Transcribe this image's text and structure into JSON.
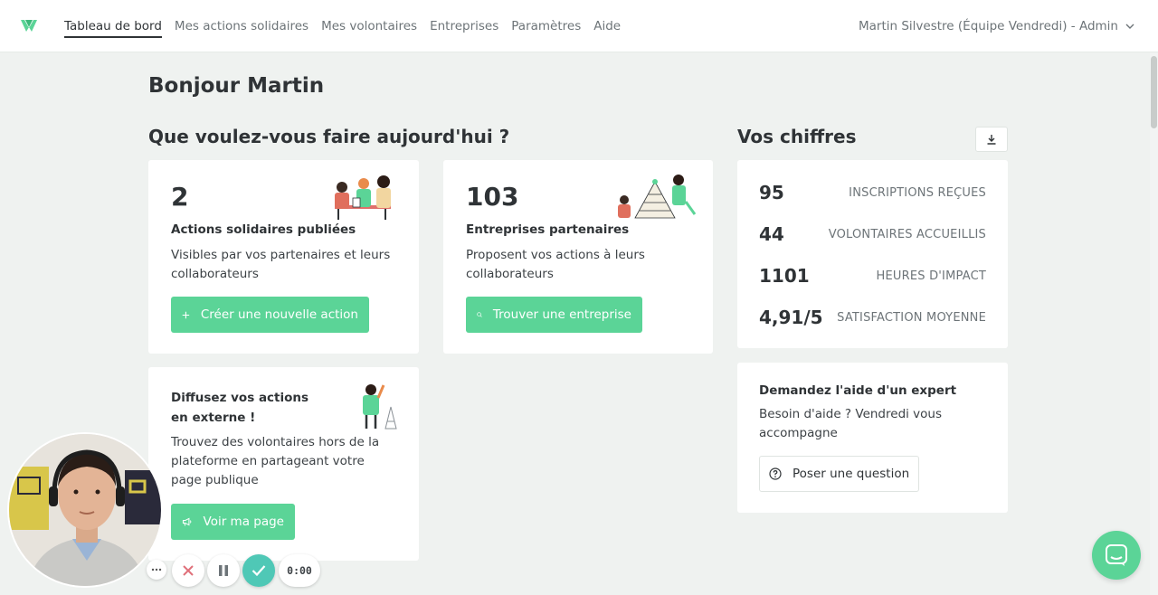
{
  "nav": {
    "items": [
      {
        "label": "Tableau de bord",
        "active": true
      },
      {
        "label": "Mes actions solidaires",
        "active": false
      },
      {
        "label": "Mes volontaires",
        "active": false
      },
      {
        "label": "Entreprises",
        "active": false
      },
      {
        "label": "Paramètres",
        "active": false
      },
      {
        "label": "Aide",
        "active": false
      }
    ],
    "user": "Martin Silvestre (Équipe Vendredi) - Admin"
  },
  "greeting": "Bonjour Martin",
  "actions_section": {
    "title": "Que voulez-vous faire aujourd'hui ?",
    "card_actions": {
      "number": "2",
      "title": "Actions solidaires publiées",
      "text_line1": "Visibles par vos partenaires et leurs",
      "text_line2": "collaborateurs",
      "button": "Créer une nouvelle action"
    },
    "card_partners": {
      "number": "103",
      "title": "Entreprises partenaires",
      "text_line1": "Proposent vos actions à leurs",
      "text_line2": "collaborateurs",
      "button": "Trouver une entreprise"
    },
    "card_share": {
      "title_line1": "Diffusez vos actions",
      "title_line2": "en externe !",
      "text_line1": "Trouvez des volontaires hors de la",
      "text_line2": "plateforme en partageant votre",
      "text_line3": "page publique",
      "button": "Voir ma page"
    }
  },
  "stats_section": {
    "title": "Vos chiffres",
    "rows": [
      {
        "value": "95",
        "label": "INSCRIPTIONS REÇUES"
      },
      {
        "value": "44",
        "label": "VOLONTAIRES ACCUEILLIS"
      },
      {
        "value": "1101",
        "label": "HEURES D'IMPACT"
      },
      {
        "value": "4,91/5",
        "label": "SATISFACTION MOYENNE"
      }
    ]
  },
  "expert": {
    "title": "Demandez l'aide d'un expert",
    "text_line1": "Besoin d'aide ? Vendredi vous",
    "text_line2": "accompagne",
    "button": "Poser une question"
  },
  "recorder": {
    "timer": "0:00"
  },
  "colors": {
    "accent": "#5bd497",
    "background": "#eff2f0",
    "recorder_confirm": "#4fc8b6",
    "recorder_cancel": "#e0707a"
  }
}
